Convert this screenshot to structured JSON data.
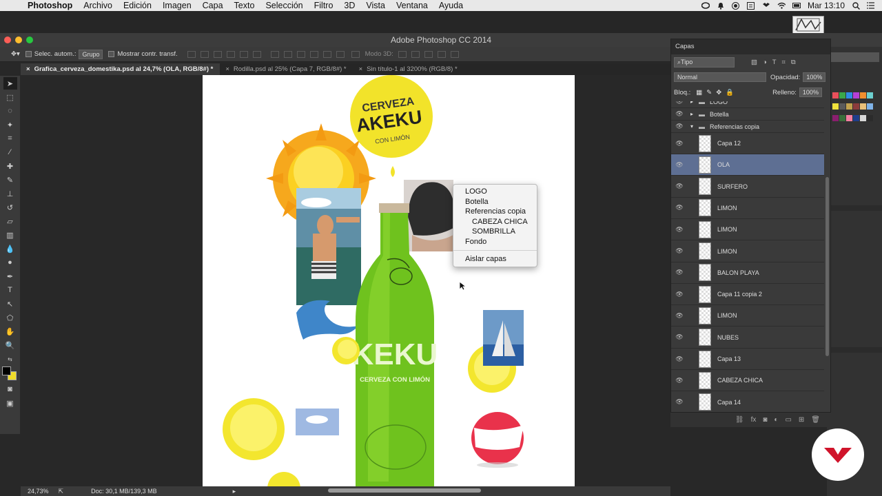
{
  "menubar": {
    "app_name": "Photoshop",
    "items": [
      "Archivo",
      "Edición",
      "Imagen",
      "Capa",
      "Texto",
      "Selección",
      "Filtro",
      "3D",
      "Vista",
      "Ventana",
      "Ayuda"
    ],
    "clock": "Mar 13:10"
  },
  "window": {
    "title": "Adobe Photoshop CC 2014"
  },
  "options": {
    "auto_select_label": "Selec. autom.:",
    "auto_select_value": "Grupo",
    "show_transform_label": "Mostrar contr. transf.",
    "mode3d_label": "Modo 3D:"
  },
  "tabs": [
    {
      "label": "Grafica_cerveza_domestika.psd al 24,7% (OLA, RGB/8#) *",
      "active": true
    },
    {
      "label": "Rodilla.psd al 25% (Capa 7, RGB/8#) *",
      "active": false
    },
    {
      "label": "Sin título-1 al 3200% (RGB/8) *",
      "active": false
    }
  ],
  "canvas_art": {
    "logo_line1": "CERVEZA",
    "logo_line2": "AKEKU",
    "logo_line3": "CON LIMÓN",
    "bottle_label": "KEKU",
    "bottle_sublabel": "CERVEZA CON LIMÓN"
  },
  "context_menu": {
    "items": [
      "LOGO",
      "Botella",
      "Referencias copia",
      "CABEZA CHICA",
      "SOMBRILLA",
      "Fondo"
    ],
    "footer": "Aislar capas"
  },
  "status": {
    "zoom": "24,73%",
    "doc": "Doc: 30,1 MB/139,3 MB"
  },
  "layers_panel": {
    "title": "Capas",
    "filter": "Tipo",
    "blend_mode": "Normal",
    "opacity_label": "Opacidad:",
    "opacity_value": "100%",
    "lock_label": "Bloq.:",
    "fill_label": "Relleno:",
    "fill_value": "100%",
    "groups": [
      "LOGO",
      "Botella",
      "Referencias copia"
    ],
    "layers": [
      "Capa 12",
      "OLA",
      "SURFERO",
      "LIMON",
      "LIMON",
      "LIMON",
      "BALON PLAYA",
      "Capa 11 copia 2",
      "LIMON",
      "NUBES",
      "Capa 13",
      "CABEZA CHICA",
      "Capa 14"
    ],
    "selected_layer": "OLA"
  },
  "colors": {
    "selection": "#5e6f93",
    "bottle_green": "#6fc21e",
    "lemon_yellow": "#f2e32a",
    "badge_red": "#d0142b"
  }
}
